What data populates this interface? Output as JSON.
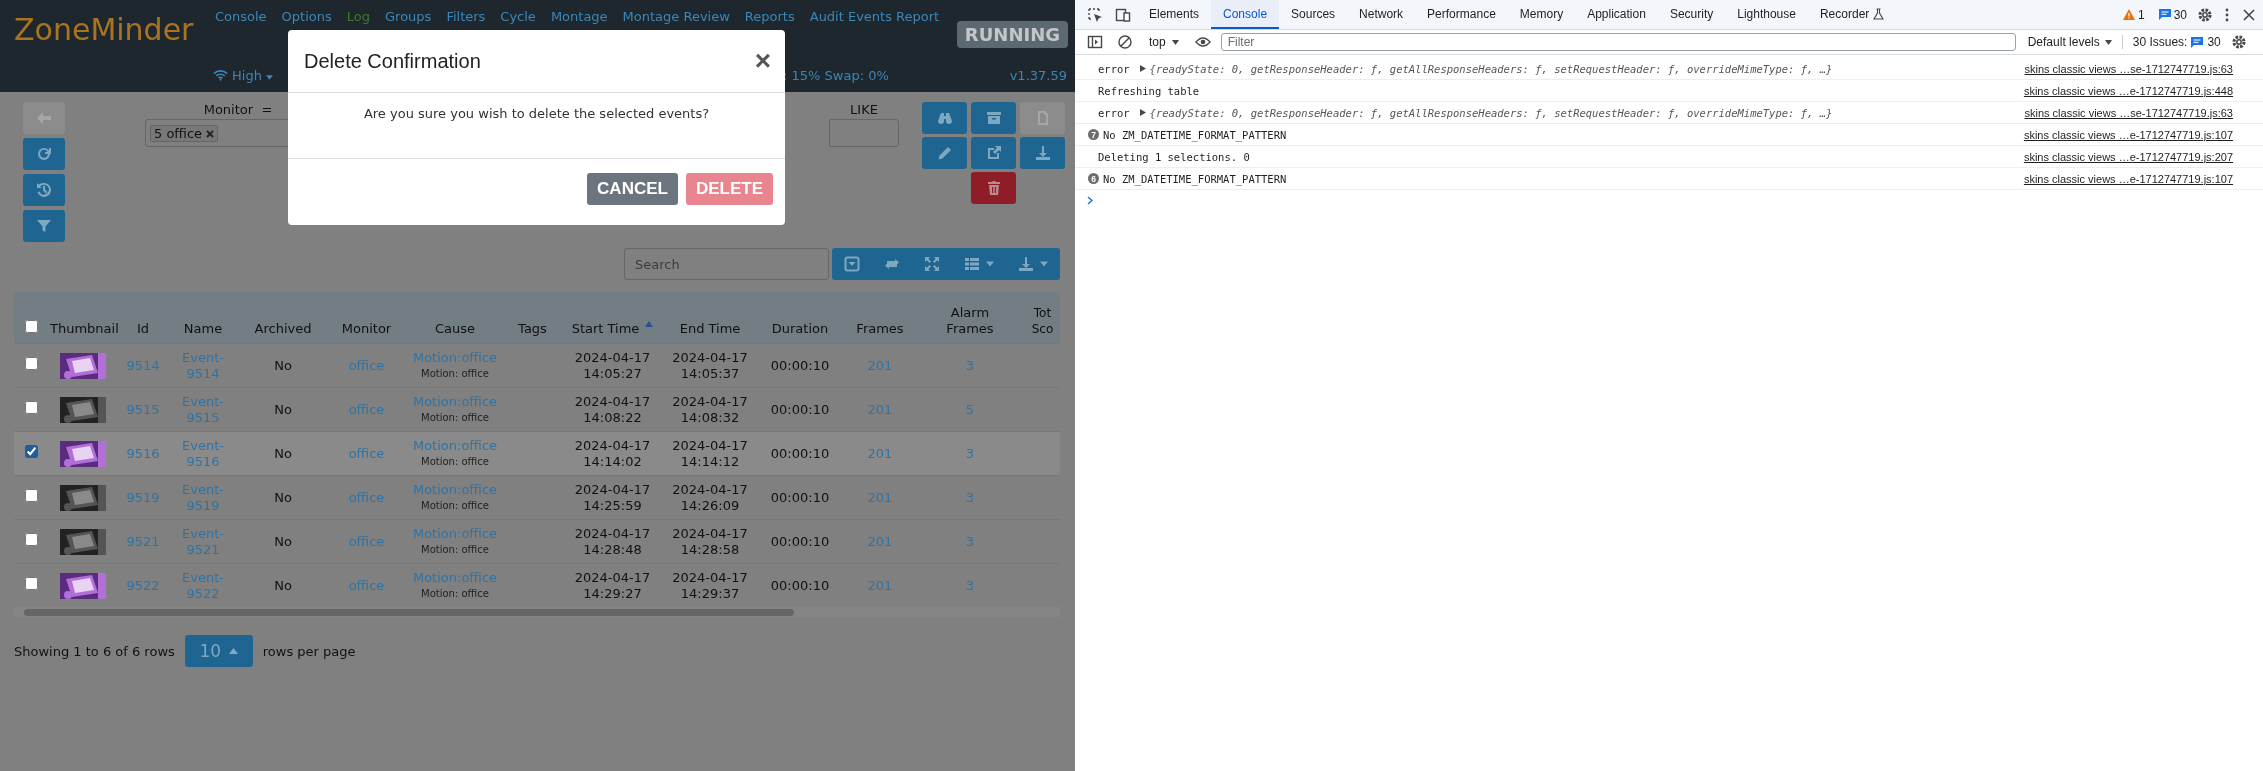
{
  "app": {
    "logo": "ZoneMinder",
    "nav": [
      {
        "label": "Console",
        "color": "#3c86b8"
      },
      {
        "label": "Options",
        "color": "#3c86b8"
      },
      {
        "label": "Log",
        "color": "#3e7a2c"
      },
      {
        "label": "Groups",
        "color": "#3c86b8"
      },
      {
        "label": "Filters",
        "color": "#3c86b8"
      },
      {
        "label": "Cycle",
        "color": "#3c86b8"
      },
      {
        "label": "Montage",
        "color": "#3c86b8"
      },
      {
        "label": "Montage Review",
        "color": "#3c86b8"
      },
      {
        "label": "Reports",
        "color": "#3c86b8"
      },
      {
        "label": "Audit Events Report",
        "color": "#3c86b8"
      }
    ],
    "state_badge": "RUNNING",
    "bandwidth": "High",
    "load": ": 15% Swap: 0%",
    "version": "v1.37.59",
    "left_tools": [
      {
        "kind": "back",
        "disabled": true
      },
      {
        "kind": "refresh",
        "disabled": false
      },
      {
        "kind": "reset",
        "disabled": false
      },
      {
        "kind": "filter",
        "disabled": false
      }
    ],
    "right_tools": [
      {
        "kind": "view",
        "disabled": false
      },
      {
        "kind": "archive",
        "disabled": false
      },
      {
        "kind": "export",
        "disabled": true
      },
      {
        "kind": "edit",
        "disabled": false
      },
      {
        "kind": "open",
        "disabled": false
      },
      {
        "kind": "download",
        "disabled": false
      },
      {
        "kind": "delete",
        "disabled": false
      }
    ],
    "filter": {
      "monitor_label": "Monitor  =",
      "monitor_tags": [
        "5 office"
      ],
      "like_label": "LIKE"
    },
    "search": {
      "placeholder": "Search"
    },
    "table": {
      "select_all": {
        "checked": false
      },
      "columns": [
        {
          "kind": "check",
          "sorted": false
        },
        {
          "label": "Thumbnail",
          "kind": "thumb",
          "sorted": false
        },
        {
          "label": "Id",
          "kind": "link",
          "sorted": false
        },
        {
          "label": "Name",
          "kind": "link",
          "sorted": false
        },
        {
          "label": "Archived",
          "kind": "text",
          "sorted": false
        },
        {
          "label": "Monitor",
          "kind": "link",
          "sorted": false
        },
        {
          "label": "Cause",
          "kind": "cause",
          "sorted": false
        },
        {
          "label": "Tags",
          "kind": "text",
          "sorted": false
        },
        {
          "label": "Start Time",
          "kind": "time",
          "sorted": true
        },
        {
          "label": "End Time",
          "kind": "time",
          "sorted": false
        },
        {
          "label": "Duration",
          "kind": "text",
          "sorted": false
        },
        {
          "label": "Frames",
          "kind": "link",
          "sorted": false
        },
        {
          "label": "Alarm Frames",
          "kind": "link",
          "sorted": false
        },
        {
          "label": "Tot Sco",
          "kind": "text",
          "sorted": false
        }
      ],
      "rows": [
        {
          "selected": false,
          "id": "9514",
          "name": "Event-9514",
          "archived": "No",
          "monitor": "office",
          "cause": "Motion:office",
          "cause_note": "Motion: office",
          "start": "2024-04-17 14:05:27",
          "end": "2024-04-17 14:05:37",
          "duration": "00:00:10",
          "frames": "201",
          "alarm_frames": "3"
        },
        {
          "selected": false,
          "id": "9515",
          "name": "Event-9515",
          "archived": "No",
          "monitor": "office",
          "cause": "Motion:office",
          "cause_note": "Motion: office",
          "start": "2024-04-17 14:08:22",
          "end": "2024-04-17 14:08:32",
          "duration": "00:00:10",
          "frames": "201",
          "alarm_frames": "5"
        },
        {
          "selected": true,
          "id": "9516",
          "name": "Event-9516",
          "archived": "No",
          "monitor": "office",
          "cause": "Motion:office",
          "cause_note": "Motion: office",
          "start": "2024-04-17 14:14:02",
          "end": "2024-04-17 14:14:12",
          "duration": "00:00:10",
          "frames": "201",
          "alarm_frames": "3"
        },
        {
          "selected": false,
          "id": "9519",
          "name": "Event-9519",
          "archived": "No",
          "monitor": "office",
          "cause": "Motion:office",
          "cause_note": "Motion: office",
          "start": "2024-04-17 14:25:59",
          "end": "2024-04-17 14:26:09",
          "duration": "00:00:10",
          "frames": "201",
          "alarm_frames": "3"
        },
        {
          "selected": false,
          "id": "9521",
          "name": "Event-9521",
          "archived": "No",
          "monitor": "office",
          "cause": "Motion:office",
          "cause_note": "Motion: office",
          "start": "2024-04-17 14:28:48",
          "end": "2024-04-17 14:28:58",
          "duration": "00:00:10",
          "frames": "201",
          "alarm_frames": "3"
        },
        {
          "selected": false,
          "id": "9522",
          "name": "Event-9522",
          "archived": "No",
          "monitor": "office",
          "cause": "Motion:office",
          "cause_note": "Motion: office",
          "start": "2024-04-17 14:29:27",
          "end": "2024-04-17 14:29:37",
          "duration": "00:00:10",
          "frames": "201",
          "alarm_frames": "3"
        }
      ]
    },
    "footer": {
      "summary": "Showing 1 to 6 of 6 rows",
      "page_size": "10",
      "suffix": "rows per page"
    }
  },
  "modal": {
    "title": "Delete Confirmation",
    "close": "×",
    "message": "Are you sure you wish to delete the selected events?",
    "buttons": [
      {
        "label": "CANCEL",
        "kind": "secondary",
        "disabled": false
      },
      {
        "label": "DELETE",
        "kind": "danger",
        "disabled": true
      }
    ]
  },
  "devtools": {
    "tabs": [
      {
        "label": "Elements",
        "selected": false
      },
      {
        "label": "Console",
        "selected": true
      },
      {
        "label": "Sources",
        "selected": false
      },
      {
        "label": "Network",
        "selected": false
      },
      {
        "label": "Performance",
        "selected": false
      },
      {
        "label": "Memory",
        "selected": false
      },
      {
        "label": "Application",
        "selected": false
      },
      {
        "label": "Security",
        "selected": false
      },
      {
        "label": "Lighthouse",
        "selected": false
      },
      {
        "label": "Recorder",
        "selected": false
      }
    ],
    "warnings": "1",
    "messages": "30",
    "context": "top",
    "filter": {
      "placeholder": "Filter"
    },
    "levels": "Default levels",
    "issues_label": "30 Issues:",
    "issues_count": "30",
    "console": [
      {
        "text": "error",
        "detail": "{readyState: 0, getResponseHeader: ƒ, getAllResponseHeaders: ƒ, setRequestHeader: ƒ, overrideMimeType: ƒ, …}",
        "source": "skins classic views …se-1712747719.js:63"
      },
      {
        "text": "Refreshing table",
        "source": "skins classic views …e-1712747719.js:448"
      },
      {
        "text": "error",
        "detail": "{readyState: 0, getResponseHeader: ƒ, getAllResponseHeaders: ƒ, setRequestHeader: ƒ, overrideMimeType: ƒ, …}",
        "source": "skins classic views …se-1712747719.js:63"
      },
      {
        "count": "7",
        "text": "No ZM_DATETIME_FORMAT_PATTERN",
        "source": "skins classic views …e-1712747719.js:107"
      },
      {
        "text": "Deleting 1 selections. 0",
        "source": "skins classic views …e-1712747719.js:207"
      },
      {
        "count": "6",
        "text": "No ZM_DATETIME_FORMAT_PATTERN",
        "source": "skins classic views …e-1712747719.js:107"
      }
    ]
  }
}
